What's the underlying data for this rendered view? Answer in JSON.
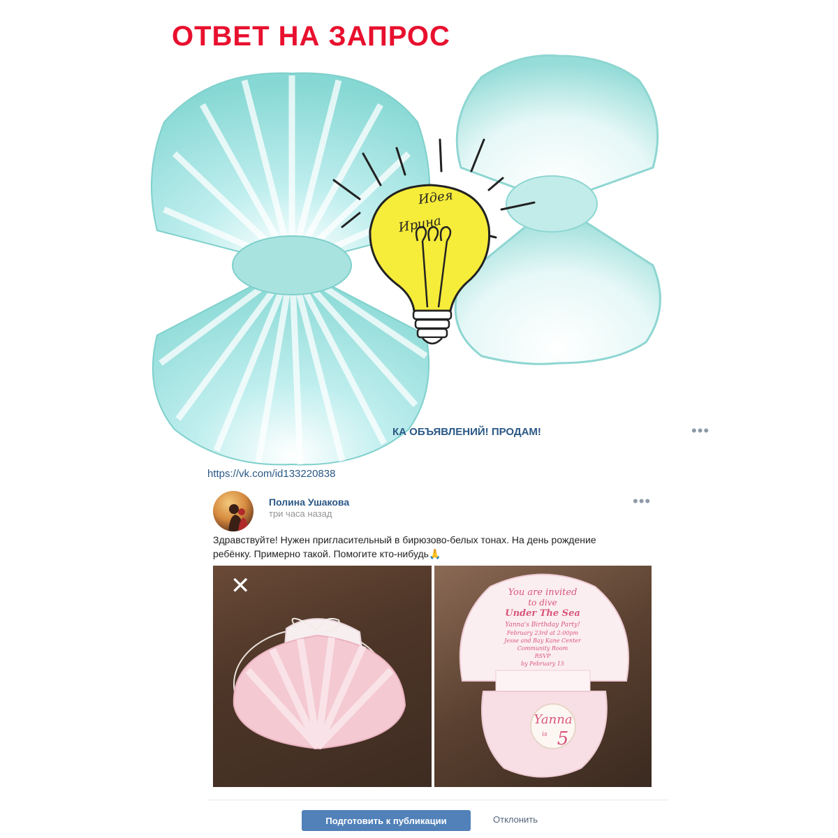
{
  "headline": "ОТВЕТ НА ЗАПРОС",
  "logo": {
    "line1": "Идея",
    "line2": "Ирина"
  },
  "group": {
    "title_visible": "КА ОБЪЯВЛЕНИЙ! ПРОДАМ!",
    "link": "https://vk.com/id133220838"
  },
  "post": {
    "author": "Полина Ушакова",
    "time": "три часа назад",
    "text": "Здравствуйте! Нужен пригласительный в бирюзово-белых тонах. На день рождение ребёнку. Примерно такой. Помогите кто-нибудь🙏",
    "more_icon": "more-horizontal-icon"
  },
  "card": {
    "l1": "You are invited",
    "l2": "to dive",
    "l3": "Under The Sea",
    "l4": "Yanna's Birthday Party!",
    "l5": "February 23rd at 2:00pm",
    "l6": "Jesse and Bay Kane Center",
    "l7": "Community Room",
    "l8": "RSVP",
    "l9": "by February 15",
    "badge_name": "Yanna",
    "badge_is": "is",
    "badge_age": "5"
  },
  "actions": {
    "primary": "Подготовить к публикации",
    "secondary": "Отклонить"
  },
  "colors": {
    "headline": "#e8102e",
    "shell": "#8fdcd8",
    "link": "#2a5885",
    "button": "#5181b8",
    "bulb": "#f7ee3a"
  }
}
